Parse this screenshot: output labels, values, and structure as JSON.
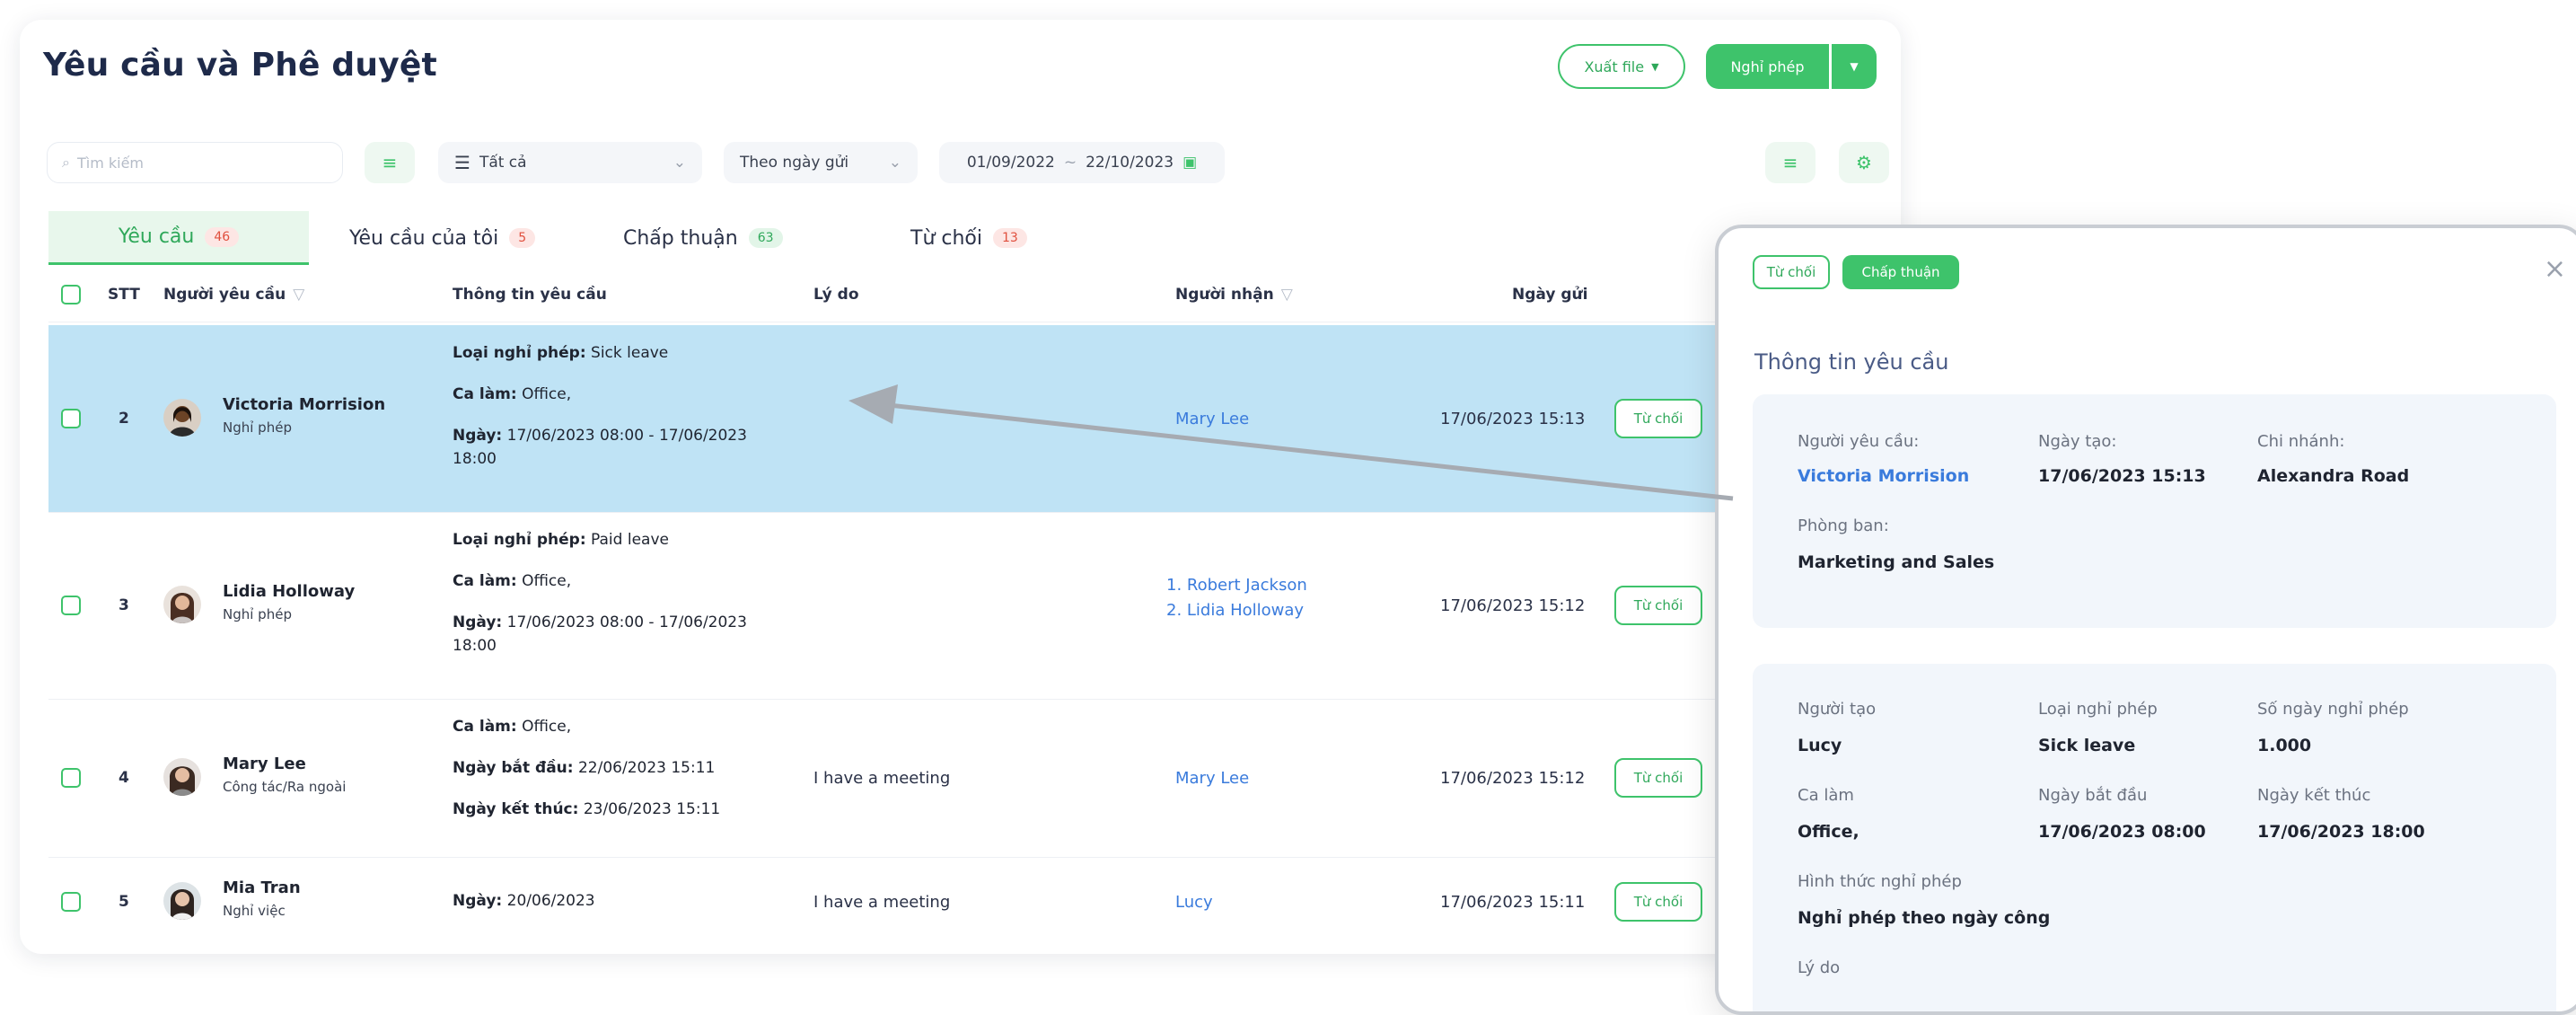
{
  "page": {
    "title": "Yêu cầu và Phê duyệt"
  },
  "header": {
    "export_label": "Xuất file",
    "leave_label": "Nghỉ phép"
  },
  "filters": {
    "search_placeholder": "Tìm kiếm",
    "type_select": "Tất cả",
    "date_select": "Theo ngày gửi",
    "date_from": "01/09/2022",
    "date_sep": "~",
    "date_to": "22/10/2023"
  },
  "tabs": [
    {
      "label": "Yêu cầu",
      "count": "46"
    },
    {
      "label": "Yêu cầu của tôi",
      "count": "5"
    },
    {
      "label": "Chấp thuận",
      "count": "63"
    },
    {
      "label": "Từ chối",
      "count": "13"
    }
  ],
  "table": {
    "headers": {
      "stt": "STT",
      "requester": "Người yêu cầu",
      "info": "Thông tin yêu cầu",
      "reason": "Lý do",
      "receiver": "Người nhận",
      "sent": "Ngày gửi"
    },
    "reject_label": "Từ chối",
    "rows": [
      {
        "stt": "2",
        "name": "Victoria Morrision",
        "type": "Nghỉ phép",
        "l1k": "Loại nghỉ phép:",
        "l1v": " Sick leave",
        "l2k": "Ca làm:",
        "l2v": " Office,",
        "l3k": "Ngày:",
        "l3v": " 17/06/2023 08:00 - 17/06/2023",
        "l3b": "18:00",
        "reason": "",
        "receiver": "Mary Lee",
        "sent": "17/06/2023 15:13"
      },
      {
        "stt": "3",
        "name": "Lidia Holloway",
        "type": "Nghỉ phép",
        "l1k": "Loại nghỉ phép:",
        "l1v": " Paid leave",
        "l2k": "Ca làm:",
        "l2v": " Office,",
        "l3k": "Ngày:",
        "l3v": " 17/06/2023 08:00 - 17/06/2023",
        "l3b": "18:00",
        "reason": "",
        "receiver1": "1. Robert Jackson",
        "receiver2": "2. Lidia Holloway",
        "sent": "17/06/2023 15:12"
      },
      {
        "stt": "4",
        "name": "Mary Lee",
        "type": "Công tác/Ra ngoài",
        "l1k": "Ca làm:",
        "l1v": " Office,",
        "l2k": "Ngày bắt đầu:",
        "l2v": " 22/06/2023 15:11",
        "l3k": "Ngày kết thúc:",
        "l3v": " 23/06/2023 15:11",
        "reason": "I have a meeting",
        "receiver": "Mary Lee",
        "sent": "17/06/2023 15:12"
      },
      {
        "stt": "5",
        "name": "Mia Tran",
        "type": "Nghỉ việc",
        "l1k": "Ngày:",
        "l1v": " 20/06/2023",
        "reason": "I have a meeting",
        "receiver": "Lucy",
        "sent": "17/06/2023 15:11"
      }
    ]
  },
  "panel": {
    "reject_label": "Từ chối",
    "approve_label": "Chấp thuận",
    "close": "×",
    "section_title": "Thông tin yêu cầu",
    "requester_label": "Người yêu cầu:",
    "requester_value": "Victoria Morrision",
    "created_label": "Ngày tạo:",
    "created_value": "17/06/2023 15:13",
    "branch_label": "Chi nhánh:",
    "branch_value": "Alexandra Road",
    "dept_label": "Phòng ban:",
    "dept_value": "Marketing and Sales",
    "creator_label": "Người tạo",
    "creator_value": "Lucy",
    "leave_type_label": "Loại nghỉ phép",
    "leave_type_value": "Sick leave",
    "days_label": "Số ngày nghỉ phép",
    "days_value": "1.000",
    "shift_label": "Ca làm",
    "shift_value": "Office,",
    "start_label": "Ngày bắt đầu",
    "start_value": "17/06/2023 08:00",
    "end_label": "Ngày kết thúc",
    "end_value": "17/06/2023 18:00",
    "form_label": "Hình thức nghỉ phép",
    "form_value": "Nghỉ phép theo ngày công",
    "reason_label": "Lý do"
  },
  "colors": {
    "accent": "#3ec36b",
    "selected_row": "#bfe3f5",
    "link": "#3a7bdc",
    "badge_red": "#e0503e"
  }
}
